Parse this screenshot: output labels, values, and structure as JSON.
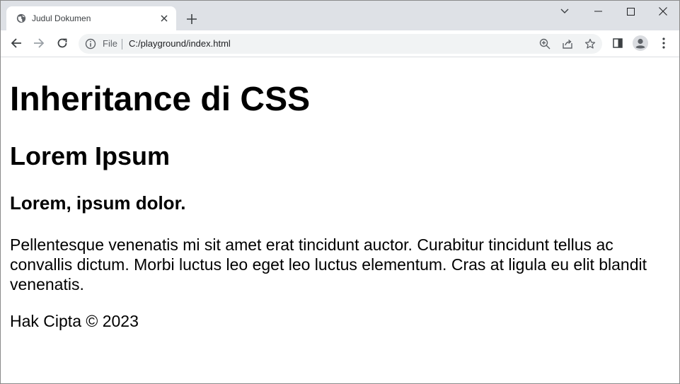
{
  "tab": {
    "title": "Judul Dokumen",
    "favicon": "globe-icon"
  },
  "toolbar": {
    "scheme_label": "File",
    "url": "C:/playground/index.html"
  },
  "page": {
    "h1": "Inheritance di CSS",
    "h2": "Lorem Ipsum",
    "h3": "Lorem, ipsum dolor.",
    "paragraph": "Pellentesque venenatis mi sit amet erat tincidunt auctor. Curabitur tincidunt tellus ac convallis dictum. Morbi luctus leo eget leo luctus elementum. Cras at ligula eu elit blandit venenatis.",
    "footer": "Hak Cipta © 2023"
  },
  "colors": {
    "tabstrip": "#dee1e6",
    "omnibox": "#f1f3f4",
    "icon": "#5f6368"
  }
}
